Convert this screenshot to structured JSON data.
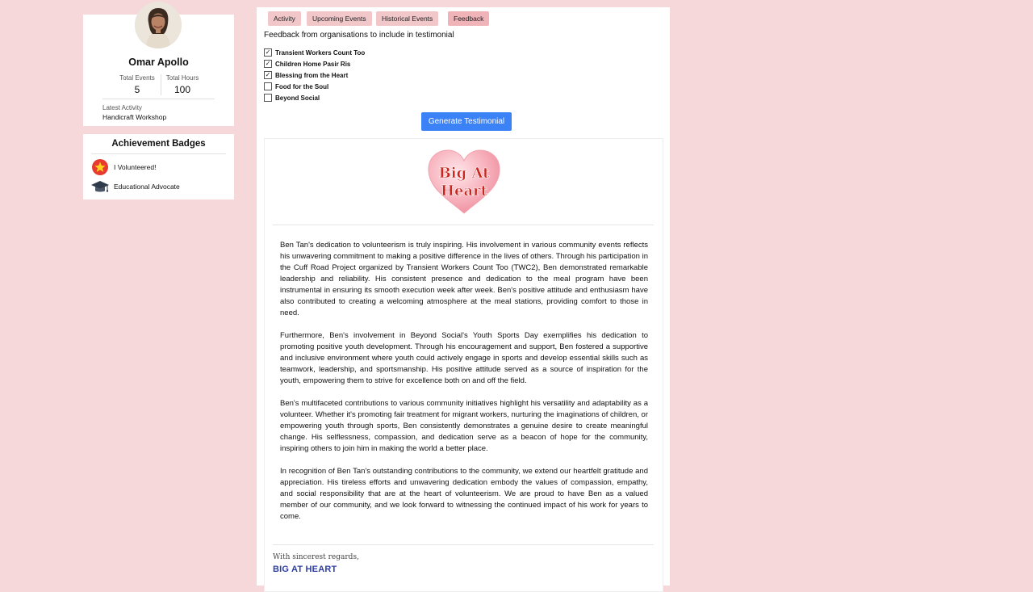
{
  "profile": {
    "name": "Omar Apollo",
    "stats": [
      {
        "label": "Total Events",
        "value": "5"
      },
      {
        "label": "Total Hours",
        "value": "100"
      }
    ],
    "latest_activity_label": "Latest Activity",
    "latest_activity_value": "Handicraft Workshop"
  },
  "badges": {
    "title": "Achievement Badges",
    "items": [
      {
        "label": "I Volunteered!",
        "icon": "star-medal-icon"
      },
      {
        "label": "Educational Advocate",
        "icon": "graduation-cap-icon"
      }
    ]
  },
  "tabs": [
    {
      "label": "Activity"
    },
    {
      "label": "Upcoming Events"
    },
    {
      "label": "Historical Events"
    },
    {
      "label": "Feedback",
      "active": true
    }
  ],
  "feedback": {
    "heading": "Feedback from organisations to include in testimonial",
    "organisations": [
      {
        "name": "Transient Workers Count Too",
        "checked": true
      },
      {
        "name": "Children Home Pasir Ris",
        "checked": true
      },
      {
        "name": "Blessing from the Heart",
        "checked": true
      },
      {
        "name": "Food for the Soul",
        "checked": false
      },
      {
        "name": "Beyond Social",
        "checked": false
      }
    ],
    "generate_label": "Generate Testimonial"
  },
  "letter": {
    "logo_line1": "Big At",
    "logo_line2": "Heart",
    "paragraphs": [
      "Ben Tan's dedication to volunteerism is truly inspiring. His involvement in various community events reflects his unwavering commitment to making a positive difference in the lives of others. Through his participation in the Cuff Road Project organized by Transient Workers Count Too (TWC2), Ben demonstrated remarkable leadership and reliability. His consistent presence and dedication to the meal program have been instrumental in ensuring its smooth execution week after week. Ben's positive attitude and enthusiasm have also contributed to creating a welcoming atmosphere at the meal stations, providing comfort to those in need.",
      "Furthermore, Ben's involvement in Beyond Social's Youth Sports Day exemplifies his dedication to promoting positive youth development. Through his encouragement and support, Ben fostered a supportive and inclusive environment where youth could actively engage in sports and develop essential skills such as teamwork, leadership, and sportsmanship. His positive attitude served as a source of inspiration for the youth, empowering them to strive for excellence both on and off the field.",
      "Ben's multifaceted contributions to various community initiatives highlight his versatility and adaptability as a volunteer. Whether it's promoting fair treatment for migrant workers, nurturing the imaginations of children, or empowering youth through sports, Ben consistently demonstrates a genuine desire to create meaningful change. His selflessness, compassion, and dedication serve as a beacon of hope for the community, inspiring others to join him in making the world a better place.",
      "In recognition of Ben Tan's outstanding contributions to the community, we extend our heartfelt gratitude and appreciation. His tireless efforts and unwavering dedication embody the values of compassion, empathy, and social responsibility that are at the heart of volunteerism. We are proud to have Ben as a valued member of our community, and we look forward to witnessing the continued impact of his work for years to come."
    ],
    "signoff": "With sincerest regards,",
    "signature": "BIG AT HEART"
  }
}
